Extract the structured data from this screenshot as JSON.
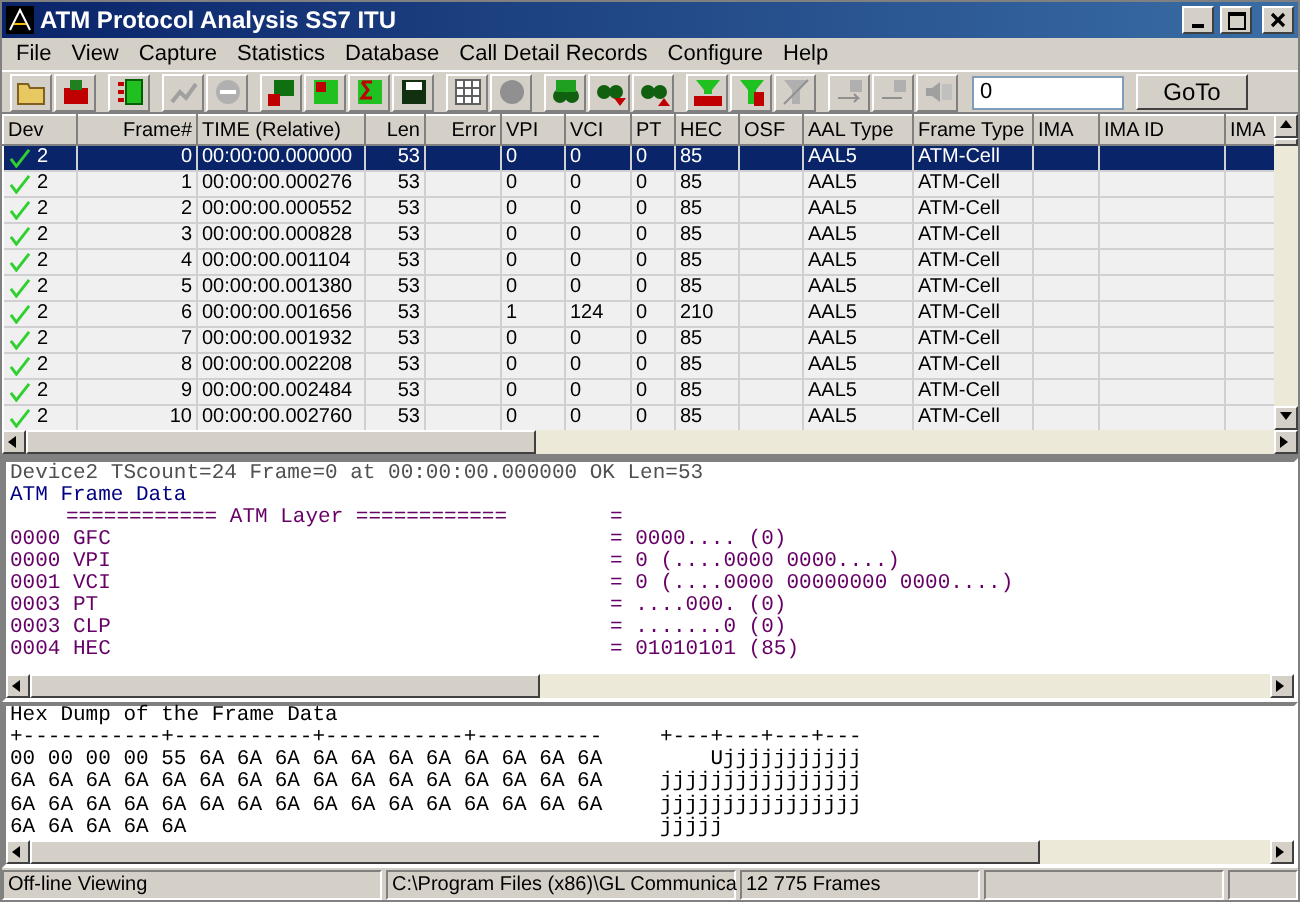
{
  "window": {
    "title": "ATM Protocol Analysis SS7 ITU"
  },
  "menu": [
    "File",
    "View",
    "Capture",
    "Statistics",
    "Database",
    "Call Detail Records",
    "Configure",
    "Help"
  ],
  "goto": {
    "value": "0",
    "button": "GoTo"
  },
  "table": {
    "columns": [
      "Dev",
      "Frame#",
      "TIME (Relative)",
      "Len",
      "Error",
      "VPI",
      "VCI",
      "PT",
      "HEC",
      "OSF",
      "AAL Type",
      "Frame Type",
      "IMA",
      "IMA ID",
      "IMA"
    ],
    "rows": [
      {
        "selected": true,
        "dev": "2",
        "frame": "0",
        "time": "00:00:00.000000",
        "len": "53",
        "vpi": "0",
        "vci": "0",
        "pt": "0",
        "hec": "85",
        "aal_type": "AAL5",
        "frame_type": "ATM-Cell"
      },
      {
        "selected": false,
        "dev": "2",
        "frame": "1",
        "time": "00:00:00.000276",
        "len": "53",
        "vpi": "0",
        "vci": "0",
        "pt": "0",
        "hec": "85",
        "aal_type": "AAL5",
        "frame_type": "ATM-Cell"
      },
      {
        "selected": false,
        "dev": "2",
        "frame": "2",
        "time": "00:00:00.000552",
        "len": "53",
        "vpi": "0",
        "vci": "0",
        "pt": "0",
        "hec": "85",
        "aal_type": "AAL5",
        "frame_type": "ATM-Cell"
      },
      {
        "selected": false,
        "dev": "2",
        "frame": "3",
        "time": "00:00:00.000828",
        "len": "53",
        "vpi": "0",
        "vci": "0",
        "pt": "0",
        "hec": "85",
        "aal_type": "AAL5",
        "frame_type": "ATM-Cell"
      },
      {
        "selected": false,
        "dev": "2",
        "frame": "4",
        "time": "00:00:00.001104",
        "len": "53",
        "vpi": "0",
        "vci": "0",
        "pt": "0",
        "hec": "85",
        "aal_type": "AAL5",
        "frame_type": "ATM-Cell"
      },
      {
        "selected": false,
        "dev": "2",
        "frame": "5",
        "time": "00:00:00.001380",
        "len": "53",
        "vpi": "0",
        "vci": "0",
        "pt": "0",
        "hec": "85",
        "aal_type": "AAL5",
        "frame_type": "ATM-Cell"
      },
      {
        "selected": false,
        "dev": "2",
        "frame": "6",
        "time": "00:00:00.001656",
        "len": "53",
        "vpi": "1",
        "vci": "124",
        "pt": "0",
        "hec": "210",
        "aal_type": "AAL5",
        "frame_type": "ATM-Cell"
      },
      {
        "selected": false,
        "dev": "2",
        "frame": "7",
        "time": "00:00:00.001932",
        "len": "53",
        "vpi": "0",
        "vci": "0",
        "pt": "0",
        "hec": "85",
        "aal_type": "AAL5",
        "frame_type": "ATM-Cell"
      },
      {
        "selected": false,
        "dev": "2",
        "frame": "8",
        "time": "00:00:00.002208",
        "len": "53",
        "vpi": "0",
        "vci": "0",
        "pt": "0",
        "hec": "85",
        "aal_type": "AAL5",
        "frame_type": "ATM-Cell"
      },
      {
        "selected": false,
        "dev": "2",
        "frame": "9",
        "time": "00:00:00.002484",
        "len": "53",
        "vpi": "0",
        "vci": "0",
        "pt": "0",
        "hec": "85",
        "aal_type": "AAL5",
        "frame_type": "ATM-Cell"
      },
      {
        "selected": false,
        "dev": "2",
        "frame": "10",
        "time": "00:00:00.002760",
        "len": "53",
        "vpi": "0",
        "vci": "0",
        "pt": "0",
        "hec": "85",
        "aal_type": "AAL5",
        "frame_type": "ATM-Cell"
      }
    ]
  },
  "detail": {
    "summary": "Device2 TScount=24 Frame=0 at 00:00:00.000000 OK Len=53",
    "heading": "ATM Frame Data",
    "lines": [
      {
        "kind": "section",
        "name": "============ ATM Layer ============",
        "value": "="
      },
      {
        "kind": "field",
        "name": "0000 GFC",
        "value": "= 0000.... (0)"
      },
      {
        "kind": "field",
        "name": "0000 VPI",
        "value": "= 0 (....0000 0000....)"
      },
      {
        "kind": "field",
        "name": "0001 VCI",
        "value": "= 0 (....0000 00000000 0000....)"
      },
      {
        "kind": "field",
        "name": "0003 PT",
        "value": "= ....000. (0)"
      },
      {
        "kind": "field",
        "name": "0003 CLP",
        "value": "= .......0 (0)"
      },
      {
        "kind": "field",
        "name": "0004 HEC",
        "value": "= 01010101 (85)"
      }
    ]
  },
  "hex_dump": {
    "title": "Hex Dump of the Frame Data",
    "hex_ruler": "+-----------+-----------+-----------+----------",
    "ascii_ruler": "+---+---+---+---",
    "rows": [
      {
        "hex": "00 00 00 00 55 6A 6A 6A 6A 6A 6A 6A 6A 6A 6A 6A",
        "ascii": "    Ujjjjjjjjjjj"
      },
      {
        "hex": "6A 6A 6A 6A 6A 6A 6A 6A 6A 6A 6A 6A 6A 6A 6A 6A",
        "ascii": "jjjjjjjjjjjjjjjj"
      },
      {
        "hex": "6A 6A 6A 6A 6A 6A 6A 6A 6A 6A 6A 6A 6A 6A 6A 6A",
        "ascii": "jjjjjjjjjjjjjjjj"
      },
      {
        "hex": "6A 6A 6A 6A 6A",
        "ascii": "jjjjj"
      }
    ]
  },
  "status_bar": [
    "Off-line Viewing",
    "C:\\Program Files (x86)\\GL Communica",
    "12 775 Frames"
  ]
}
